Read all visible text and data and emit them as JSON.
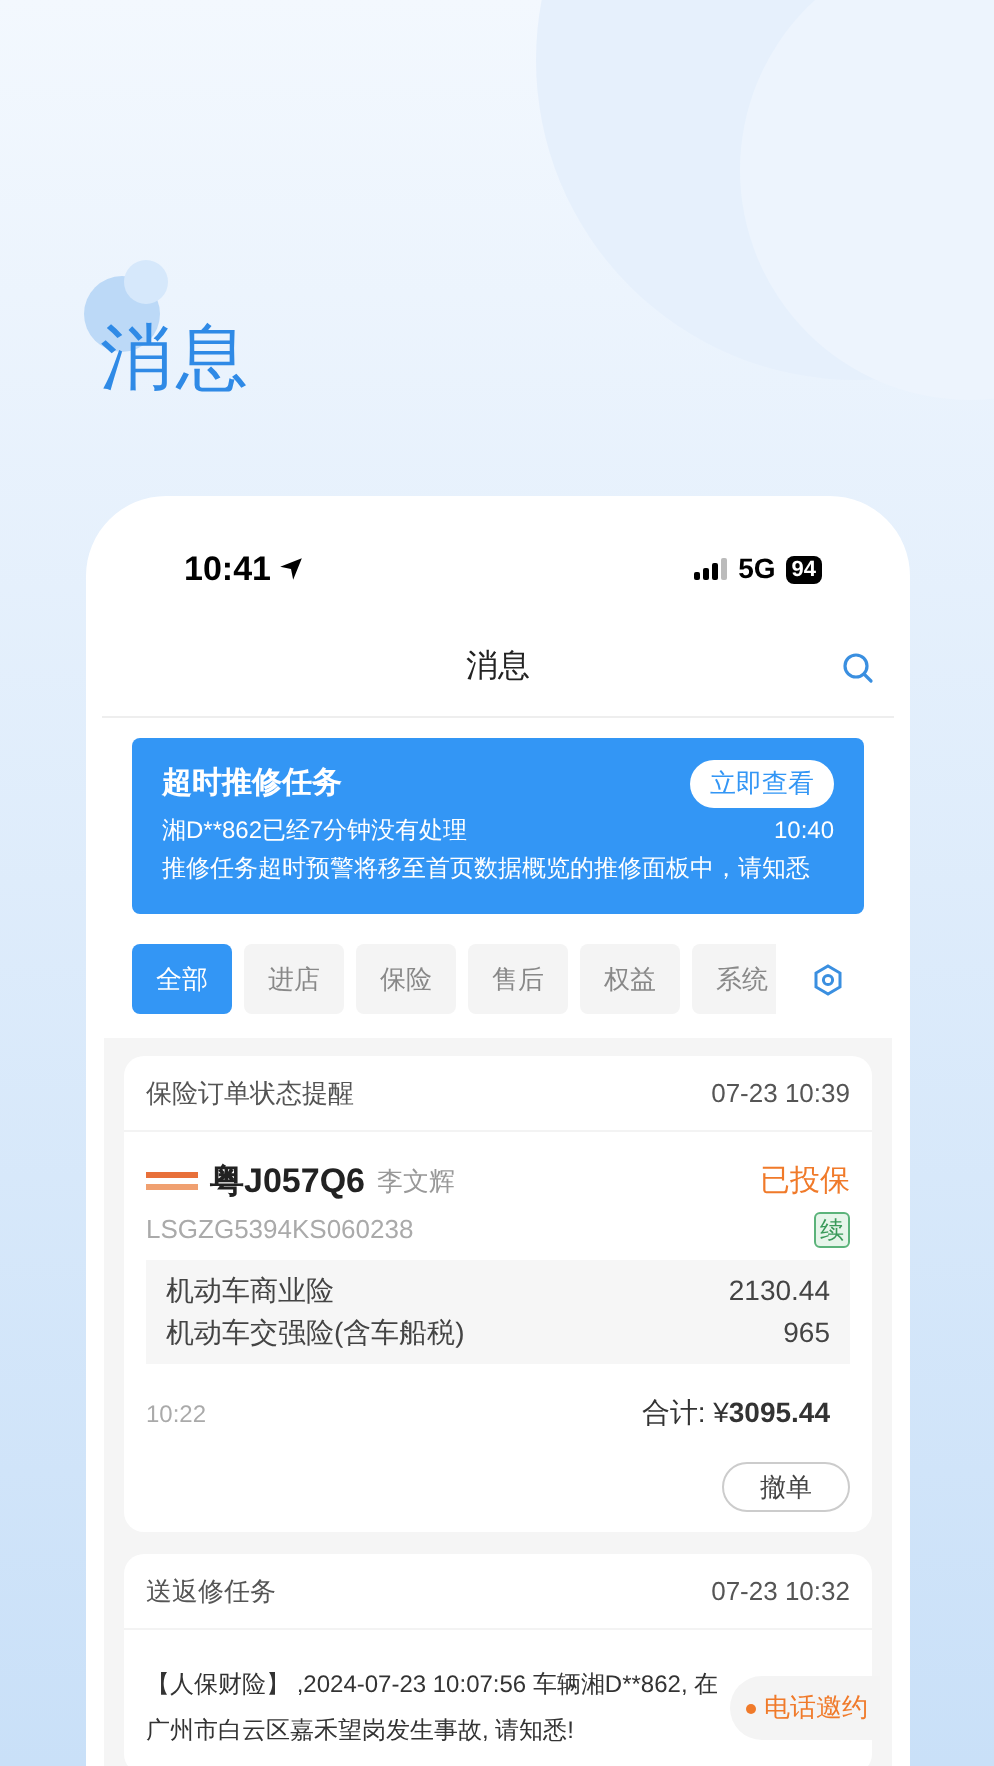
{
  "page_title": "消息",
  "status_bar": {
    "time": "10:41",
    "network": "5G",
    "battery": "94"
  },
  "nav": {
    "title": "消息"
  },
  "alert": {
    "title": "超时推修任务",
    "button": "立即查看",
    "message": "湘D**862已经7分钟没有处理",
    "time": "10:40",
    "note": "推修任务超时预警将移至首页数据概览的推修面板中，请知悉"
  },
  "tabs": [
    {
      "label": "全部",
      "selected": true
    },
    {
      "label": "进店",
      "selected": false
    },
    {
      "label": "保险",
      "selected": false
    },
    {
      "label": "售后",
      "selected": false
    },
    {
      "label": "权益",
      "selected": false
    },
    {
      "label": "系统",
      "selected": false
    }
  ],
  "messages": [
    {
      "kind": "insurance",
      "title": "保险订单状态提醒",
      "time": "07-23 10:39",
      "plate": "粤J057Q6",
      "owner": "李文辉",
      "status": "已投保",
      "vin": "LSGZG5394KS060238",
      "tag": "续",
      "items": [
        {
          "name": "机动车商业险",
          "amount": "2130.44"
        },
        {
          "name": "机动车交强险(含车船税)",
          "amount": "965"
        }
      ],
      "created": "10:22",
      "total": "合计: ¥**3095.44**",
      "action": "撤单"
    },
    {
      "kind": "repair",
      "title": "送返修任务",
      "time": "07-23 10:32",
      "text": "【人保财险】 ,2024-07-23 10:07:56 车辆湘D**862, 在广州市白云区嘉禾望岗发生事故, 请知悉!",
      "action": "电话邀约"
    }
  ]
}
